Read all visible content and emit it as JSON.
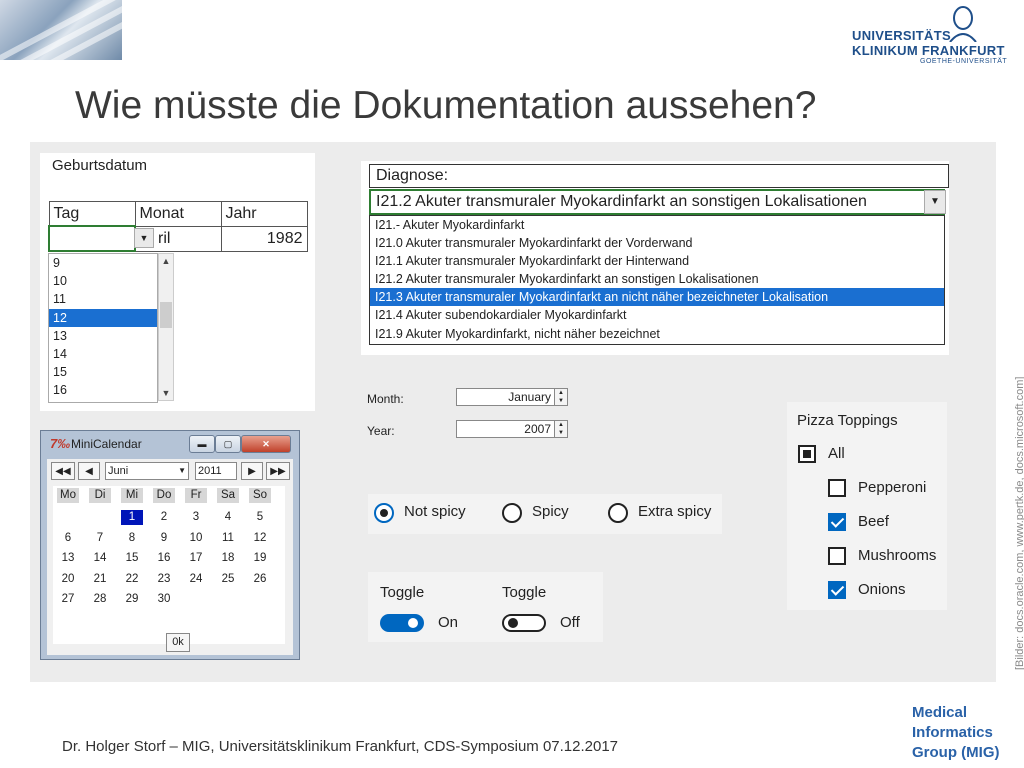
{
  "slide": {
    "title": "Wie müsste die Dokumentation aussehen?",
    "footer": "Dr. Holger Storf – MIG, Universitätsklinikum Frankfurt, CDS-Symposium 07.12.2017",
    "source_note": "[Bilder: docs.oracle.com, www.pertk.de, docs.microsoft.com]",
    "logo": {
      "line1": "UNIVERSITÄTS",
      "line2": "KLINIKUM FRANKFURT",
      "line3": "GOETHE-UNIVERSITÄT"
    },
    "mig": [
      "Medical",
      "Informatics",
      "Group (MIG)"
    ]
  },
  "geburtsdatum": {
    "label": "Geburtsdatum",
    "headers": [
      "Tag",
      "Monat",
      "Jahr"
    ],
    "values": {
      "tag": "",
      "monat": "ril",
      "jahr": "1982"
    },
    "options": [
      "9",
      "10",
      "11",
      "12",
      "13",
      "14",
      "15",
      "16"
    ],
    "selected": "12"
  },
  "diagnose": {
    "label": "Diagnose:",
    "selected_value": "I21.2 Akuter transmuraler Myokardinfarkt an sonstigen Lokalisationen",
    "options": [
      "I21.- Akuter Myokardinfarkt",
      "I21.0 Akuter transmuraler Myokardinfarkt der Vorderwand",
      "I21.1 Akuter transmuraler Myokardinfarkt der Hinterwand",
      "I21.2 Akuter transmuraler Myokardinfarkt an sonstigen Lokalisationen",
      "I21.3 Akuter transmuraler Myokardinfarkt an nicht näher bezeichneter Lokalisation",
      "I21.4 Akuter subendokardialer Myokardinfarkt",
      "I21.9 Akuter Myokardinfarkt, nicht näher bezeichnet"
    ],
    "highlighted": "I21.3 Akuter transmuraler Myokardinfarkt an nicht näher bezeichneter Lokalisation"
  },
  "spinners": {
    "month_label": "Month:",
    "month_value": "January",
    "year_label": "Year:",
    "year_value": "2007"
  },
  "minicalendar": {
    "title": "MiniCalendar",
    "month": "Juni",
    "year": "2011",
    "weekdays": [
      "Mo",
      "Di",
      "Mi",
      "Do",
      "Fr",
      "Sa",
      "So"
    ],
    "weeks": [
      [
        "",
        "",
        "1",
        "2",
        "3",
        "4",
        "5"
      ],
      [
        "6",
        "7",
        "8",
        "9",
        "10",
        "11",
        "12"
      ],
      [
        "13",
        "14",
        "15",
        "16",
        "17",
        "18",
        "19"
      ],
      [
        "20",
        "21",
        "22",
        "23",
        "24",
        "25",
        "26"
      ],
      [
        "27",
        "28",
        "29",
        "30",
        "",
        "",
        ""
      ]
    ],
    "selected_day": "1",
    "ok_label": "0k",
    "nav": {
      "prev_year": "◀◀",
      "prev_month": "◀",
      "next_month": "▶",
      "next_year": "▶▶"
    }
  },
  "radios": {
    "options": [
      "Not spicy",
      "Spicy",
      "Extra spicy"
    ],
    "selected": "Not spicy"
  },
  "toggles": [
    {
      "header": "Toggle",
      "state": "On",
      "on": true
    },
    {
      "header": "Toggle",
      "state": "Off",
      "on": false
    }
  ],
  "pizza": {
    "title": "Pizza Toppings",
    "all_label": "All",
    "all_state": "indeterminate",
    "items": [
      {
        "label": "Pepperoni",
        "checked": false
      },
      {
        "label": "Beef",
        "checked": true
      },
      {
        "label": "Mushrooms",
        "checked": false
      },
      {
        "label": "Onions",
        "checked": true
      }
    ]
  },
  "colors": {
    "accent": "#0067c0",
    "selection": "#1a6fd1",
    "calendar_selection": "#0015b8",
    "logo": "#1f4f8a",
    "combo_border": "#2e7d32"
  }
}
